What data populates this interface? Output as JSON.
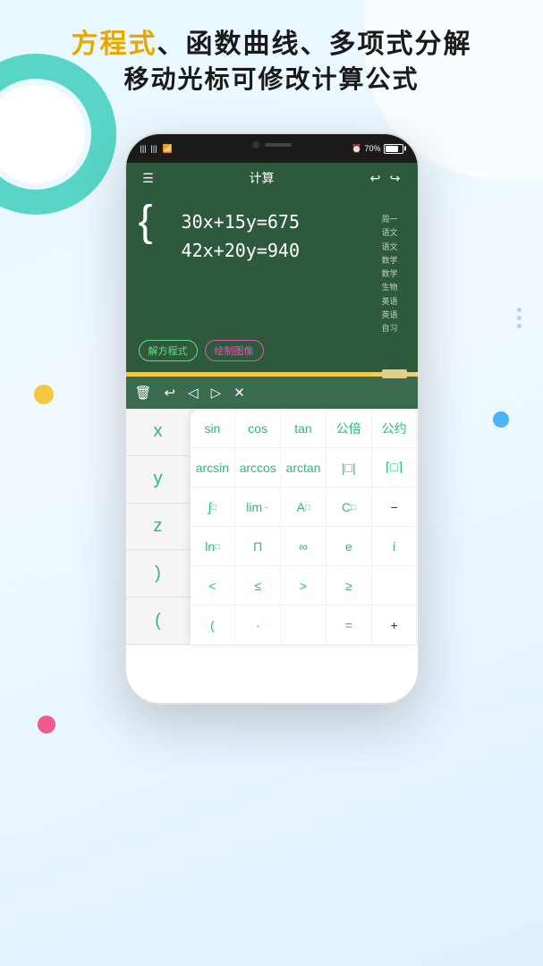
{
  "header": {
    "line1": "方程式、函数曲线、多项式分解",
    "line2": "移动光标可修改计算公式",
    "highlight_chars": "方程式",
    "accent_color": "#e8a800"
  },
  "phone": {
    "status": {
      "signal": "|||.|||",
      "wifi": "WiFi",
      "battery_level": "70%",
      "alarm": "⏰"
    },
    "toolbar": {
      "menu_icon": "☰",
      "title": "计算",
      "undo_icon": "↩",
      "redo_icon": "↪"
    },
    "display": {
      "equation1": "30x+15y=675",
      "equation2": "42x+20y=940",
      "side_menu": [
        "周一",
        "语文",
        "语文",
        "数学",
        "数学",
        "生物",
        "英语",
        "英语",
        "自习"
      ]
    },
    "action_buttons": {
      "solve": "解方程式",
      "draw": "绘制图像"
    },
    "edit_toolbar_icons": [
      "🗑",
      "↩",
      "◁",
      "▷",
      "✕"
    ]
  },
  "keyboard": {
    "left_keys": [
      "x",
      "y",
      "z",
      ")",
      "("
    ],
    "right_keys": [
      [
        "sin",
        "cos",
        "tan",
        "公倍",
        "公约"
      ],
      [
        "arcsin",
        "arccos",
        "arctan",
        "| |",
        "⌈ ⌉"
      ],
      [
        "∫□",
        "lim",
        "A□",
        "C□",
        "−"
      ],
      [
        "ln□",
        "Π",
        "∞",
        "e",
        "i"
      ],
      [
        "<",
        "≤",
        ">",
        "≥",
        ""
      ],
      [
        "(",
        "·",
        "",
        "=",
        "+"
      ]
    ]
  }
}
